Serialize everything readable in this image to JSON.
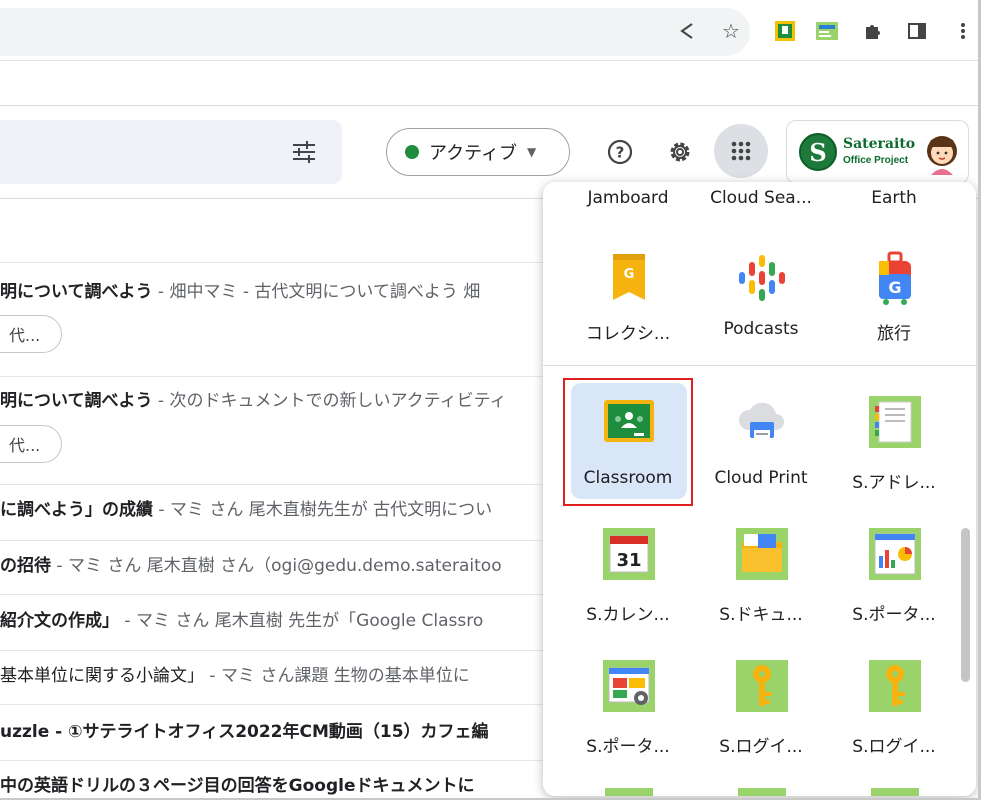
{
  "status": {
    "label": "アクティブ",
    "color": "#1e8e3e"
  },
  "account": {
    "logo_letter": "S",
    "logo_line1": "Sateraito",
    "logo_line2": "Office Project"
  },
  "toolbar_icons": [
    "share-icon",
    "star-icon",
    "extension-icon-1",
    "extension-icon-2",
    "puzzle-icon",
    "sidepanel-icon",
    "more-vert-icon"
  ],
  "mail_rows": [
    {
      "subject": "明について調べよう",
      "snippet": " - 畑中マミ - 古代文明について調べよう 畑"
    },
    {
      "subject": "明について調べよう",
      "snippet": " - 次のドキュメントでの新しいアクティビティ"
    },
    {
      "subject": "に調べよう」の成績",
      "snippet": " - マミ さん 尾木直樹先生が 古代文明につい"
    },
    {
      "subject": "の招待",
      "snippet": " - マミ さん 尾木直樹 さん（ogi@gedu.demo.sateraitoo"
    },
    {
      "subject": "紹介文の作成」",
      "snippet": " - マミ さん 尾木直樹 先生が「Google Classro"
    },
    {
      "subject": "基本単位に関する小論文」",
      "snippet": " - マミ さん課題 生物の基本単位に"
    },
    {
      "subject": "uzzle - ①サテライトオフィス2022年CM動画（15）カフェ編",
      "snippet": ""
    },
    {
      "subject": "中の英語ドリルの３ページ目の回答をGoogleドキュメントに",
      "snippet": ""
    }
  ],
  "chips": [
    "代...",
    "代..."
  ],
  "apps_top_row": [
    "Jamboard",
    "Cloud Sea...",
    "Earth"
  ],
  "apps": [
    {
      "label": "コレクシ...",
      "icon": "collections-icon"
    },
    {
      "label": "Podcasts",
      "icon": "podcasts-icon"
    },
    {
      "label": "旅行",
      "icon": "travel-icon"
    },
    {
      "label": "Classroom",
      "icon": "classroom-icon"
    },
    {
      "label": "Cloud Print",
      "icon": "cloud-print-icon"
    },
    {
      "label": "S.アドレ...",
      "icon": "s-address-icon"
    },
    {
      "label": "S.カレン...",
      "icon": "s-calendar-icon",
      "day": "31"
    },
    {
      "label": "S.ドキュ...",
      "icon": "s-docs-icon"
    },
    {
      "label": "S.ポータ...",
      "icon": "s-portal-icon"
    },
    {
      "label": "S.ポータ...",
      "icon": "s-portal-2-icon"
    },
    {
      "label": "S.ログイ...",
      "icon": "s-login-icon"
    },
    {
      "label": "S.ログイ...",
      "icon": "s-login-2-icon"
    }
  ]
}
